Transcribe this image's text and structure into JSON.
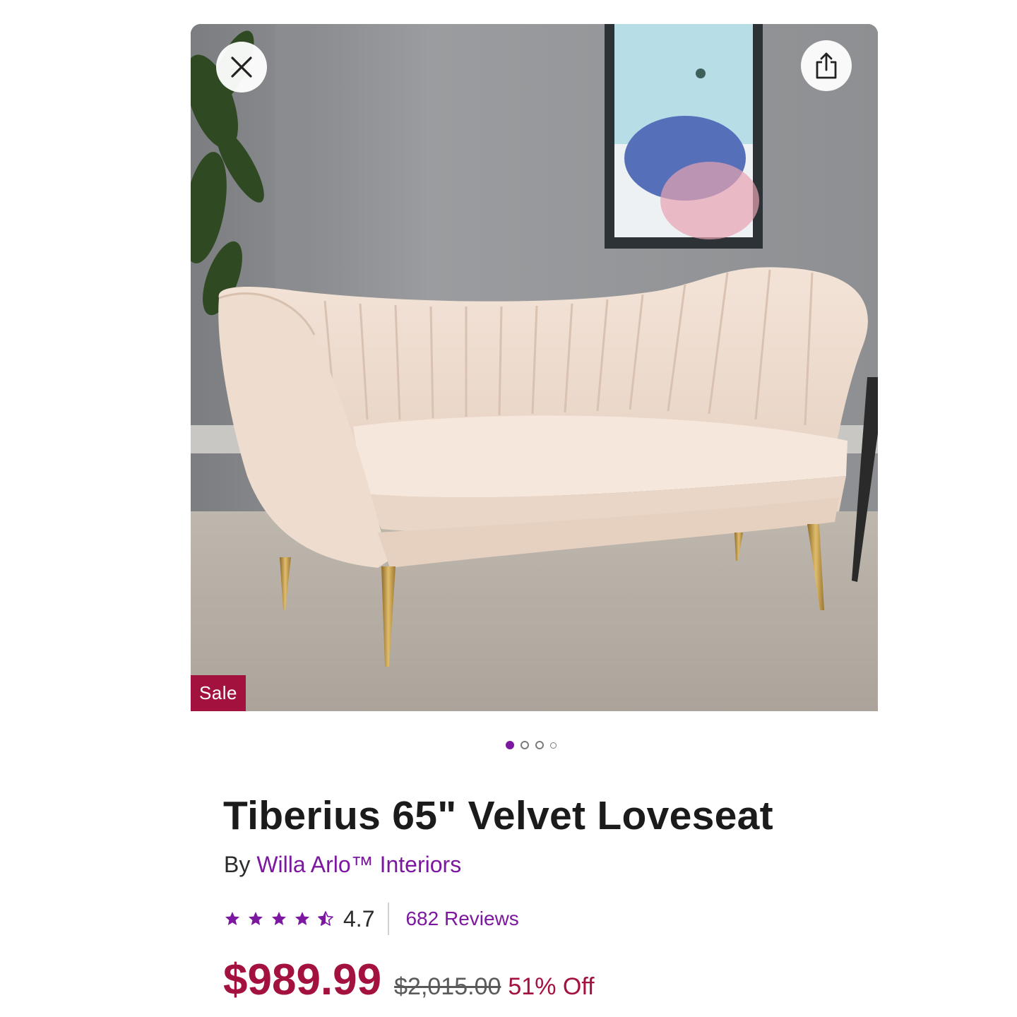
{
  "gallery": {
    "badge": "Sale",
    "active_index": 0,
    "image_count": 4
  },
  "product": {
    "title": "Tiberius 65\" Velvet Loveseat",
    "by_label": "By",
    "brand": "Willa Arlo™ Interiors",
    "rating": {
      "value": "4.7",
      "stars": 4.5,
      "reviews_label": "682 Reviews"
    },
    "price": {
      "sale": "$989.99",
      "original": "$2,015.00",
      "discount": "51% Off"
    }
  },
  "icons": {
    "close": "close-icon",
    "share": "share-icon",
    "star": "star-icon",
    "half_star": "half-star-icon"
  },
  "colors": {
    "accent": "#7b189f",
    "sale": "#a3123f",
    "text": "#1b1b1b"
  }
}
